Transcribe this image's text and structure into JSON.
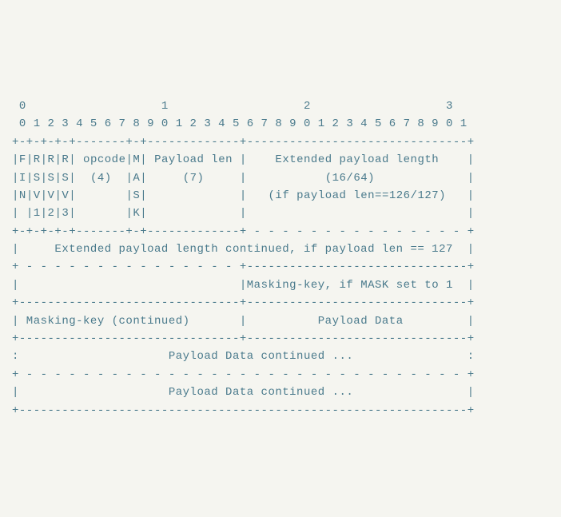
{
  "ruler": {
    "major": " 0                   1                   2                   3",
    "minor": " 0 1 2 3 4 5 6 7 8 9 0 1 2 3 4 5 6 7 8 9 0 1 2 3 4 5 6 7 8 9 0 1"
  },
  "sep": {
    "full_solid": "+-+-+-+-+-------+-+-------------+-------------------------------+",
    "dashed_all": "+ - - - - - - - - - - - - - - - +-------------------------------+",
    "header_end": "+-+-+-+-+-------+-+-------------+ - - - - - - - - - - - - - - - +",
    "dashed_full": "+ - - - - - - - - - - - - - - - - - - - - - - - - - - - - - - - +",
    "mid_solid": "+-------------------------------+-------------------------------+",
    "mask_cont": "+-------------------------------+-------------------------------+",
    "bottom": "+---------------------------------------------------------------+",
    "dashed_full2": "+ - - - - - - - - - - - - - - - - - - - - - - - - - - - - - - - +"
  },
  "r1": {
    "c1": "F",
    "c2": "R",
    "c3": "R",
    "c4": "R",
    "c5": " opcode",
    "c6": "M",
    "c7": " Payload len ",
    "c8": "    Extended payload length    "
  },
  "r2": {
    "c1": "I",
    "c2": "S",
    "c3": "S",
    "c4": "S",
    "c5": "  (4)  ",
    "c6": "A",
    "c7": "     (7)     ",
    "c8": "           (16/64)             "
  },
  "r3": {
    "c1": "N",
    "c2": "V",
    "c3": "V",
    "c4": "V",
    "c5": "       ",
    "c6": "S",
    "c7": "             ",
    "c8": "   (if payload len==126/127)   "
  },
  "r4": {
    "c1": " ",
    "c2": "1",
    "c3": "2",
    "c4": "3",
    "c5": "       ",
    "c6": "K",
    "c7": "             ",
    "c8": "                               "
  },
  "ext_cont": "     Extended payload length continued, if payload len == 127  ",
  "mask_row": {
    "left": "                               ",
    "right": "Masking-key, if MASK set to 1  "
  },
  "mask_cont_row": {
    "left": " Masking-key (continued)       ",
    "right": "          Payload Data         "
  },
  "payload_cont1": "                     Payload Data continued ...                ",
  "payload_cont2": "                     Payload Data continued ...                "
}
